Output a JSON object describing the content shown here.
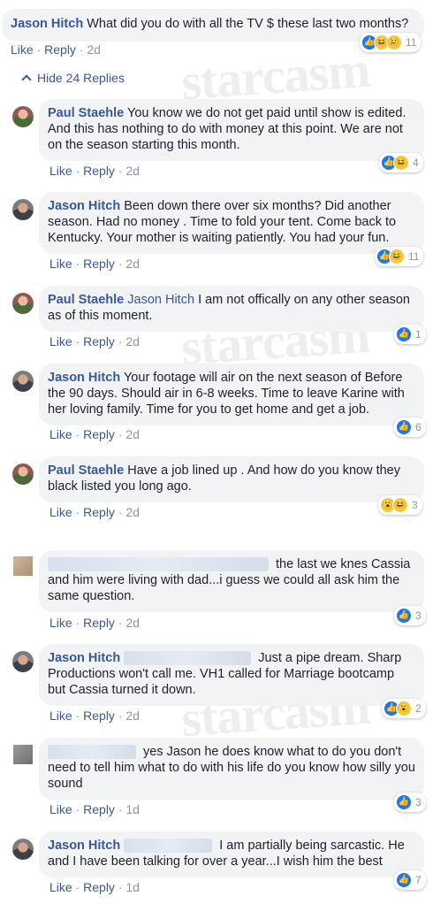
{
  "watermark": "starcasm",
  "top_comment": {
    "author": "Jason Hitch",
    "text": "What did you do with all the TV $ these last two months?",
    "like": "Like",
    "reply": "Reply",
    "time": "2d",
    "reactions": [
      "like",
      "haha",
      "sad"
    ],
    "reaction_count": "11"
  },
  "hide_replies": "Hide 24 Replies",
  "replies": [
    {
      "author": "Paul Staehle",
      "mention": "",
      "text": "You know we do not get paid until show is edited. And this has nothing to do with money at this point. We are not on the season starting this month.",
      "like": "Like",
      "reply": "Reply",
      "time": "2d",
      "reactions": [
        "like",
        "haha"
      ],
      "reaction_count": "4"
    },
    {
      "author": "Jason Hitch",
      "mention": "",
      "text": "Been down there over six months? Did another season. Had no money . Time to fold your tent. Come back to Kentucky. Your mother is waiting patiently. You had your fun.",
      "like": "Like",
      "reply": "Reply",
      "time": "2d",
      "reactions": [
        "like",
        "haha"
      ],
      "reaction_count": "11"
    },
    {
      "author": "Paul Staehle",
      "mention": "Jason Hitch",
      "text": "I am not offically on any other season as of this moment.",
      "like": "Like",
      "reply": "Reply",
      "time": "2d",
      "reactions": [
        "like"
      ],
      "reaction_count": "1"
    },
    {
      "author": "Jason Hitch",
      "mention": "",
      "text": "Your footage will air on the next season of Before the 90 days. Should air in 6-8 weeks. Time to leave Karine with her loving family. Time for you to get home and get a job.",
      "like": "Like",
      "reply": "Reply",
      "time": "2d",
      "reactions": [
        "like"
      ],
      "reaction_count": "6"
    },
    {
      "author": "Paul Staehle",
      "mention": "",
      "text": "Have a job lined up . And how do you know they black listed you long ago.",
      "like": "Like",
      "reply": "Reply",
      "time": "2d",
      "reactions": [
        "wow",
        "haha"
      ],
      "reaction_count": "3"
    },
    {
      "author": "",
      "mention": "",
      "text": "the last we knes Cassia and him were living with dad...i guess we could all ask him the same question.",
      "like": "Like",
      "reply": "Reply",
      "time": "2d",
      "reactions": [
        "like"
      ],
      "reaction_count": "3"
    },
    {
      "author": "Jason Hitch",
      "mention": "",
      "text": "Just a pipe dream. Sharp Productions won't call me. VH1 called for Marriage bootcamp but Cassia turned it down.",
      "like": "Like",
      "reply": "Reply",
      "time": "2d",
      "reactions": [
        "like",
        "wow"
      ],
      "reaction_count": "2"
    },
    {
      "author": "",
      "mention": "",
      "text": "yes Jason he does know what to do you don't need to tell him what to do with his life do you know how silly you sound",
      "like": "Like",
      "reply": "Reply",
      "time": "1d",
      "reactions": [
        "like"
      ],
      "reaction_count": "3"
    },
    {
      "author": "Jason Hitch",
      "mention": "",
      "text": "I am partially being sarcastic. He and I have been talking for over a year...I wish him the best",
      "like": "Like",
      "reply": "Reply",
      "time": "1d",
      "reactions": [
        "like"
      ],
      "reaction_count": "7"
    }
  ],
  "colors": {
    "link": "#385898",
    "bubble": "#f2f3f5",
    "meta": "#90949c",
    "like_blue": "#1877f2",
    "emoji_yellow": "#f7c740"
  }
}
